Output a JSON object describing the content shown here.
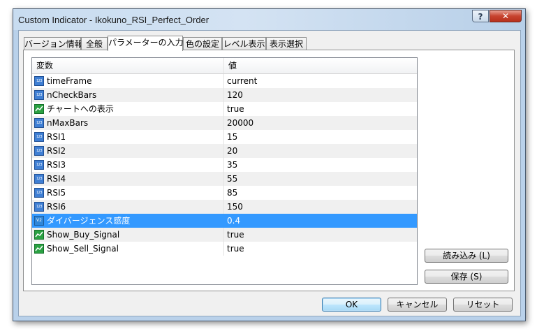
{
  "window": {
    "title": "Custom Indicator - Ikokuno_RSI_Perfect_Order",
    "help_label": "?",
    "close_label": "✕"
  },
  "tabs": [
    {
      "label": "バージョン情報"
    },
    {
      "label": "全般"
    },
    {
      "label": "パラメーターの入力"
    },
    {
      "label": "色の設定"
    },
    {
      "label": "レベル表示"
    },
    {
      "label": "表示選択"
    }
  ],
  "grid": {
    "col_variable": "変数",
    "col_value": "値",
    "rows": [
      {
        "name": "timeFrame",
        "value": "current",
        "icon": "integer-icon",
        "icon_text": "123"
      },
      {
        "name": "nCheckBars",
        "value": "120",
        "icon": "integer-icon",
        "icon_text": "123"
      },
      {
        "name": "チャートへの表示",
        "value": "true",
        "icon": "boolean-icon",
        "icon_text": ""
      },
      {
        "name": "nMaxBars",
        "value": "20000",
        "icon": "integer-icon",
        "icon_text": "123"
      },
      {
        "name": "RSI1",
        "value": "15",
        "icon": "integer-icon",
        "icon_text": "123"
      },
      {
        "name": "RSI2",
        "value": "20",
        "icon": "integer-icon",
        "icon_text": "123"
      },
      {
        "name": "RSI3",
        "value": "35",
        "icon": "integer-icon",
        "icon_text": "123"
      },
      {
        "name": "RSI4",
        "value": "55",
        "icon": "integer-icon",
        "icon_text": "123"
      },
      {
        "name": "RSI5",
        "value": "85",
        "icon": "integer-icon",
        "icon_text": "123"
      },
      {
        "name": "RSI6",
        "value": "150",
        "icon": "integer-icon",
        "icon_text": "123"
      },
      {
        "name": "ダイバージェンス感度",
        "value": "0.4",
        "icon": "double-icon",
        "icon_text": "V2"
      },
      {
        "name": "Show_Buy_Signal",
        "value": "true",
        "icon": "boolean-icon",
        "icon_text": ""
      },
      {
        "name": "Show_Sell_Signal",
        "value": "true",
        "icon": "boolean-icon",
        "icon_text": ""
      }
    ],
    "selected_index": 10
  },
  "side_buttons": {
    "load_label": "読み込み (L)",
    "save_label": "保存 (S)"
  },
  "footer_buttons": {
    "ok_label": "OK",
    "cancel_label": "キャンセル",
    "reset_label": "リセット"
  },
  "colors": {
    "selection": "#3399ff",
    "window_frame": "#b9d1ea",
    "close_button": "#c7432f"
  }
}
